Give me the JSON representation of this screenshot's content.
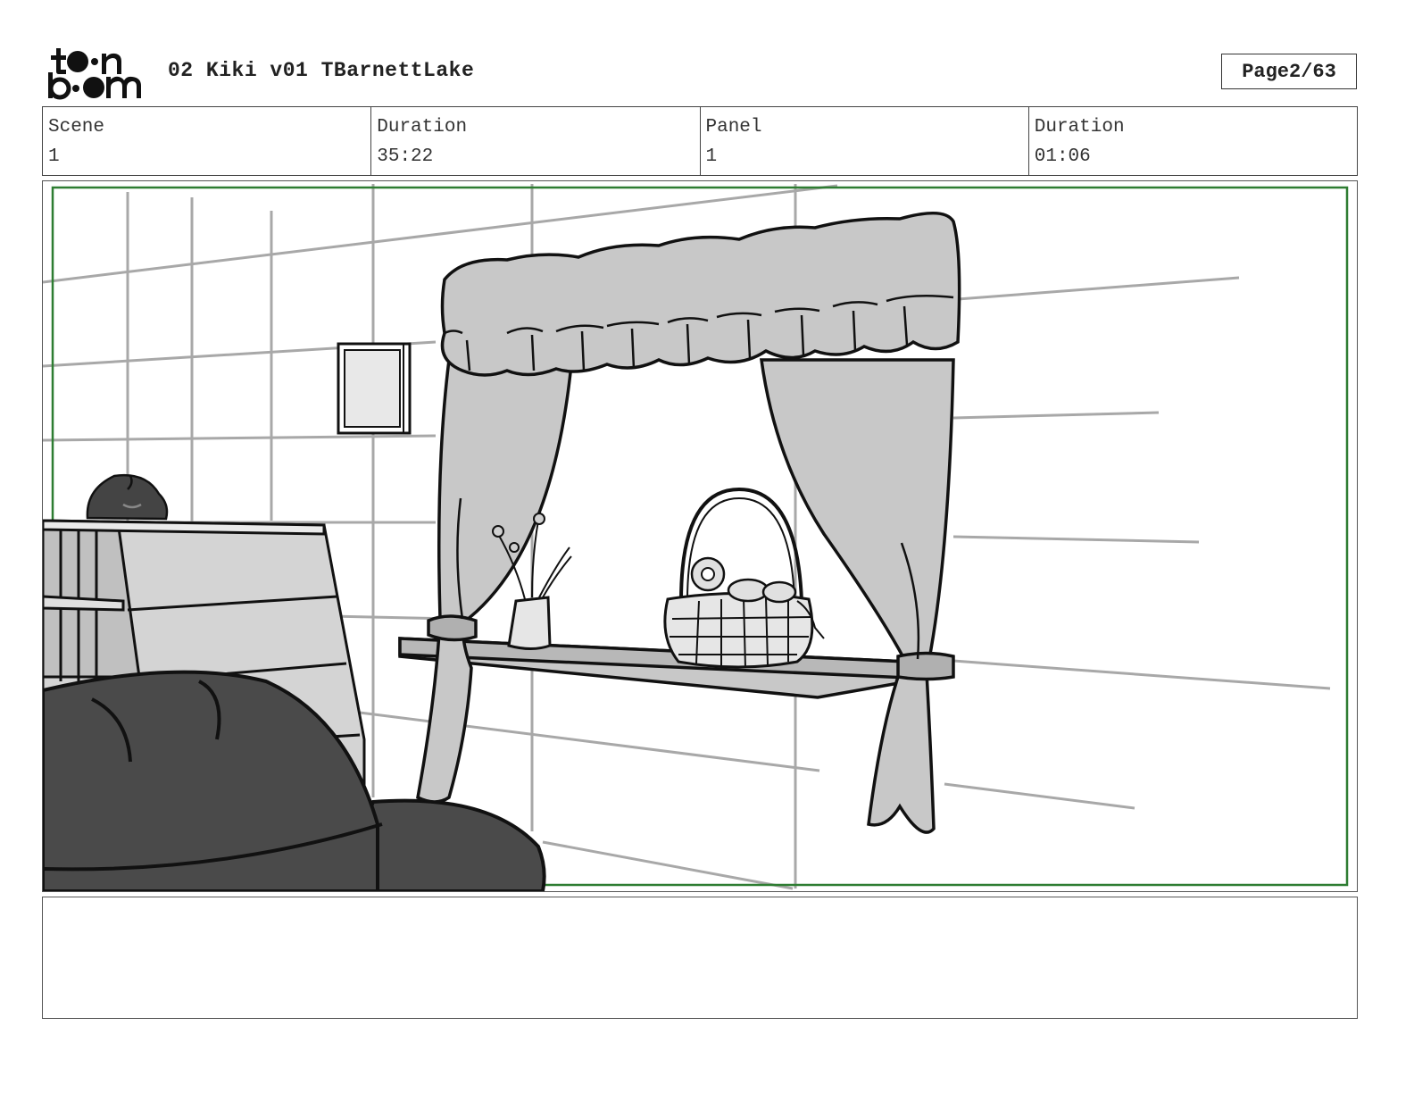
{
  "header": {
    "logo_text": "toon boom",
    "project_title": "02 Kiki v01 TBarnettLake",
    "page_label": "Page",
    "page_number": "2/63"
  },
  "info": {
    "scene_label": "Scene",
    "scene_value": "1",
    "scene_duration_label": "Duration",
    "scene_duration_value": "35:22",
    "panel_label": "Panel",
    "panel_value": "1",
    "panel_duration_label": "Duration",
    "panel_duration_value": "01:06"
  },
  "notes": {
    "text": ""
  },
  "colors": {
    "safe_area_border": "#2e7d32",
    "curtain_fill": "#c8c8c8",
    "beanbag_fill": "#4a4a4a",
    "guide_line": "#a8a8a8"
  }
}
